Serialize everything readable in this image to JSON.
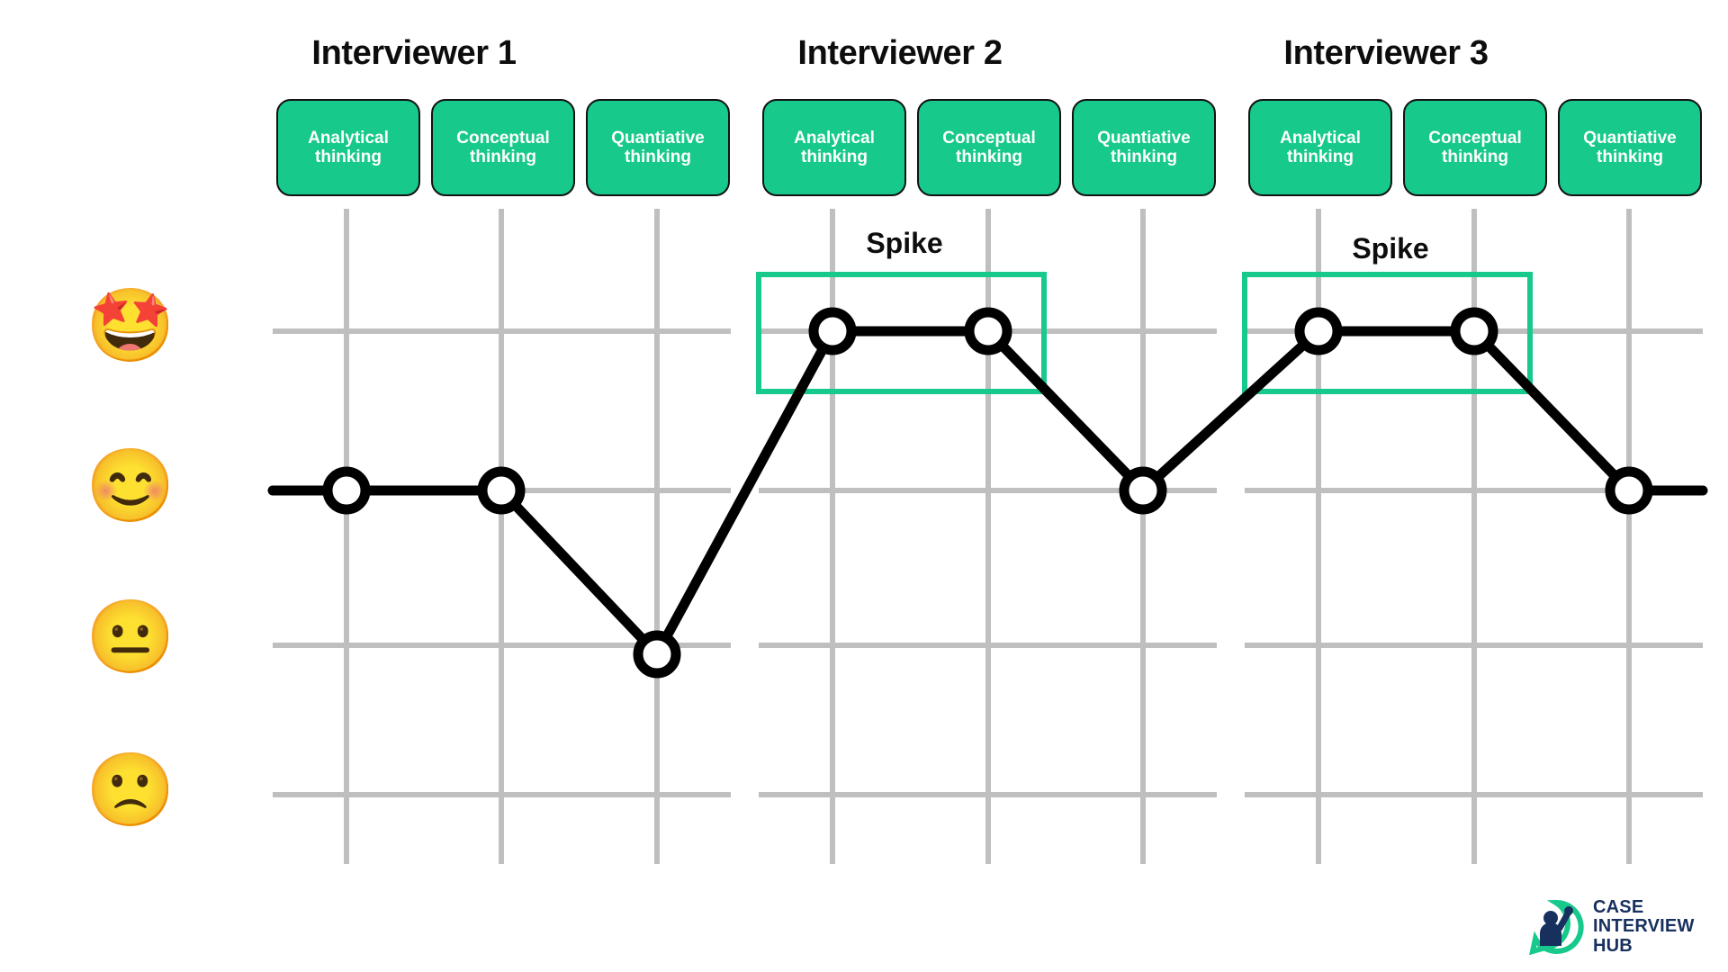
{
  "chart_data": {
    "type": "line",
    "title": "",
    "xlabel": "",
    "ylabel": "",
    "grid": true,
    "legend_position": "none",
    "y_scale_labels": [
      "star-struck",
      "smiling",
      "neutral",
      "slightly-frowning"
    ],
    "y_scale_emoji": [
      "🤩",
      "😊",
      "😐",
      "🙁"
    ],
    "y_levels": [
      4,
      3,
      2,
      1
    ],
    "categories": [
      "Interviewer 1 / Analytical thinking",
      "Interviewer 1 / Conceptual thinking",
      "Interviewer 1 / Quantitative thinking",
      "Interviewer 2 / Analytical thinking",
      "Interviewer 2 / Conceptual thinking",
      "Interviewer 2 / Quantitative thinking",
      "Interviewer 3 / Analytical thinking",
      "Interviewer 3 / Conceptual thinking",
      "Interviewer 3 / Quantitative thinking"
    ],
    "values": [
      3,
      3,
      1.8,
      4,
      4,
      3,
      4,
      4,
      3
    ],
    "value_labels": [
      "smiling",
      "smiling",
      "below-neutral",
      "star-struck",
      "star-struck",
      "smiling",
      "star-struck",
      "star-struck",
      "smiling"
    ],
    "ylim": [
      0.5,
      4.6
    ],
    "annotations": [
      {
        "text": "Spike",
        "covers": [
          "Interviewer 2 / Analytical thinking",
          "Interviewer 2 / Conceptual thinking"
        ]
      },
      {
        "text": "Spike",
        "covers": [
          "Interviewer 3 / Analytical thinking",
          "Interviewer 3 / Conceptual thinking"
        ]
      }
    ]
  },
  "colors": {
    "chip_fill": "#17c98a",
    "chip_border": "#121212",
    "chip_text": "#ffffff",
    "line": "#000000",
    "marker_fill": "#ffffff",
    "grid": "#bfbfbf",
    "highlight_box": "#17c98a",
    "title_text": "#0d0d0d",
    "logo_navy": "#17305e",
    "logo_green": "#17c98a",
    "background": "#ffffff"
  },
  "groups": [
    {
      "title": "Interviewer 1",
      "chips": [
        {
          "line1": "Analytical",
          "line2": "thinking"
        },
        {
          "line1": "Conceptual",
          "line2": "thinking"
        },
        {
          "line1": "Quantiative",
          "line2": "thinking"
        }
      ]
    },
    {
      "title": "Interviewer 2",
      "chips": [
        {
          "line1": "Analytical",
          "line2": "thinking"
        },
        {
          "line1": "Conceptual",
          "line2": "thinking"
        },
        {
          "line1": "Quantiative",
          "line2": "thinking"
        }
      ]
    },
    {
      "title": "Interviewer 3",
      "chips": [
        {
          "line1": "Analytical",
          "line2": "thinking"
        },
        {
          "line1": "Conceptual",
          "line2": "thinking"
        },
        {
          "line1": "Quantiative",
          "line2": "thinking"
        }
      ]
    }
  ],
  "scale": [
    {
      "emoji": "🤩",
      "name": "star-struck-face"
    },
    {
      "emoji": "😊",
      "name": "smiling-face"
    },
    {
      "emoji": "😐",
      "name": "neutral-face"
    },
    {
      "emoji": "🙁",
      "name": "slightly-frowning-face"
    }
  ],
  "spikes": [
    {
      "label": "Spike"
    },
    {
      "label": "Spike"
    }
  ],
  "logo": {
    "line1": "CASE",
    "line2": "INTERVIEW",
    "line3": "HUB"
  }
}
